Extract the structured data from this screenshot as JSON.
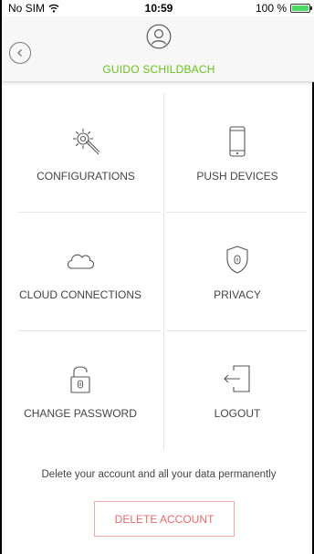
{
  "status_bar": {
    "carrier": "No SIM",
    "time": "10:59",
    "battery": "100 %",
    "battery_level": 1.0
  },
  "header": {
    "user_name": "GUIDO SCHILDBACH",
    "accent_color": "#6bbf1f"
  },
  "menu": {
    "configurations": "CONFIGURATIONS",
    "push_devices": "PUSH DEVICES",
    "cloud_connections": "CLOUD CONNECTIONS",
    "privacy": "PRIVACY",
    "change_password": "CHANGE PASSWORD",
    "logout": "LOGOUT"
  },
  "delete": {
    "note": "Delete your account and all your data permanently",
    "button_label": "DELETE ACCOUNT",
    "color": "#e06d6d"
  },
  "icons": [
    "back-arrow-icon",
    "user-avatar-icon",
    "gear-wrench-icon",
    "smartphone-icon",
    "cloud-icon",
    "shield-lock-icon",
    "padlock-open-icon",
    "logout-door-icon"
  ]
}
